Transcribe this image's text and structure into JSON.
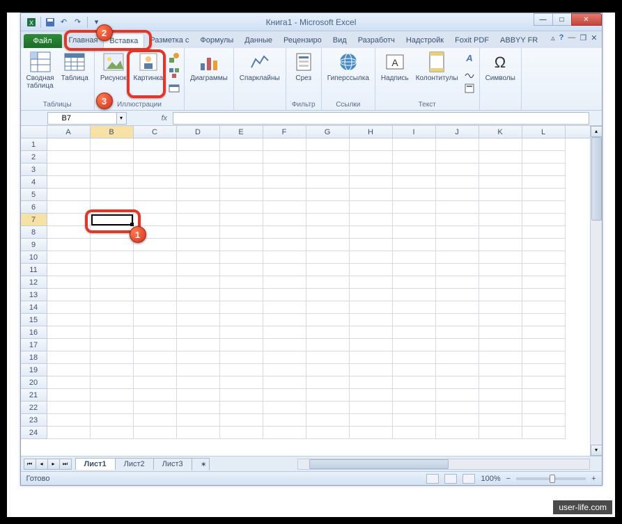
{
  "title": "Книга1 - Microsoft Excel",
  "tabs": {
    "file": "Файл",
    "items": [
      "Главная",
      "Вставка",
      "Разметка с",
      "Формулы",
      "Данные",
      "Рецензиро",
      "Вид",
      "Разработч",
      "Надстройк",
      "Foxit PDF",
      "ABBYY FR"
    ],
    "active_index": 1
  },
  "ribbon": {
    "groups": {
      "tables": {
        "label": "Таблицы",
        "pivot": "Сводная\nтаблица",
        "table": "Таблица"
      },
      "illustrations": {
        "label": "Иллюстрации",
        "picture": "Рисунок",
        "clipart": "Картинка"
      },
      "charts": {
        "label": "",
        "charts": "Диаграммы"
      },
      "sparklines": {
        "label": "",
        "sparklines": "Спарклайны"
      },
      "filter": {
        "label": "Фильтр",
        "slicer": "Срез"
      },
      "links": {
        "label": "Ссылки",
        "hyperlink": "Гиперссылка"
      },
      "text": {
        "label": "Текст",
        "textbox": "Надпись",
        "headerfooter": "Колонтитулы"
      },
      "symbols": {
        "label": "",
        "symbols": "Символы"
      }
    }
  },
  "namebox": "B7",
  "fx_label": "fx",
  "columns": [
    "A",
    "B",
    "C",
    "D",
    "E",
    "F",
    "G",
    "H",
    "I",
    "J",
    "K",
    "L"
  ],
  "selected_col": "B",
  "selected_row": 7,
  "row_count": 24,
  "sheets": {
    "items": [
      "Лист1",
      "Лист2",
      "Лист3"
    ],
    "active": 0
  },
  "status": "Готово",
  "zoom": "100%",
  "callouts": {
    "1": "1",
    "2": "2",
    "3": "3"
  },
  "watermark": "user-life.com"
}
